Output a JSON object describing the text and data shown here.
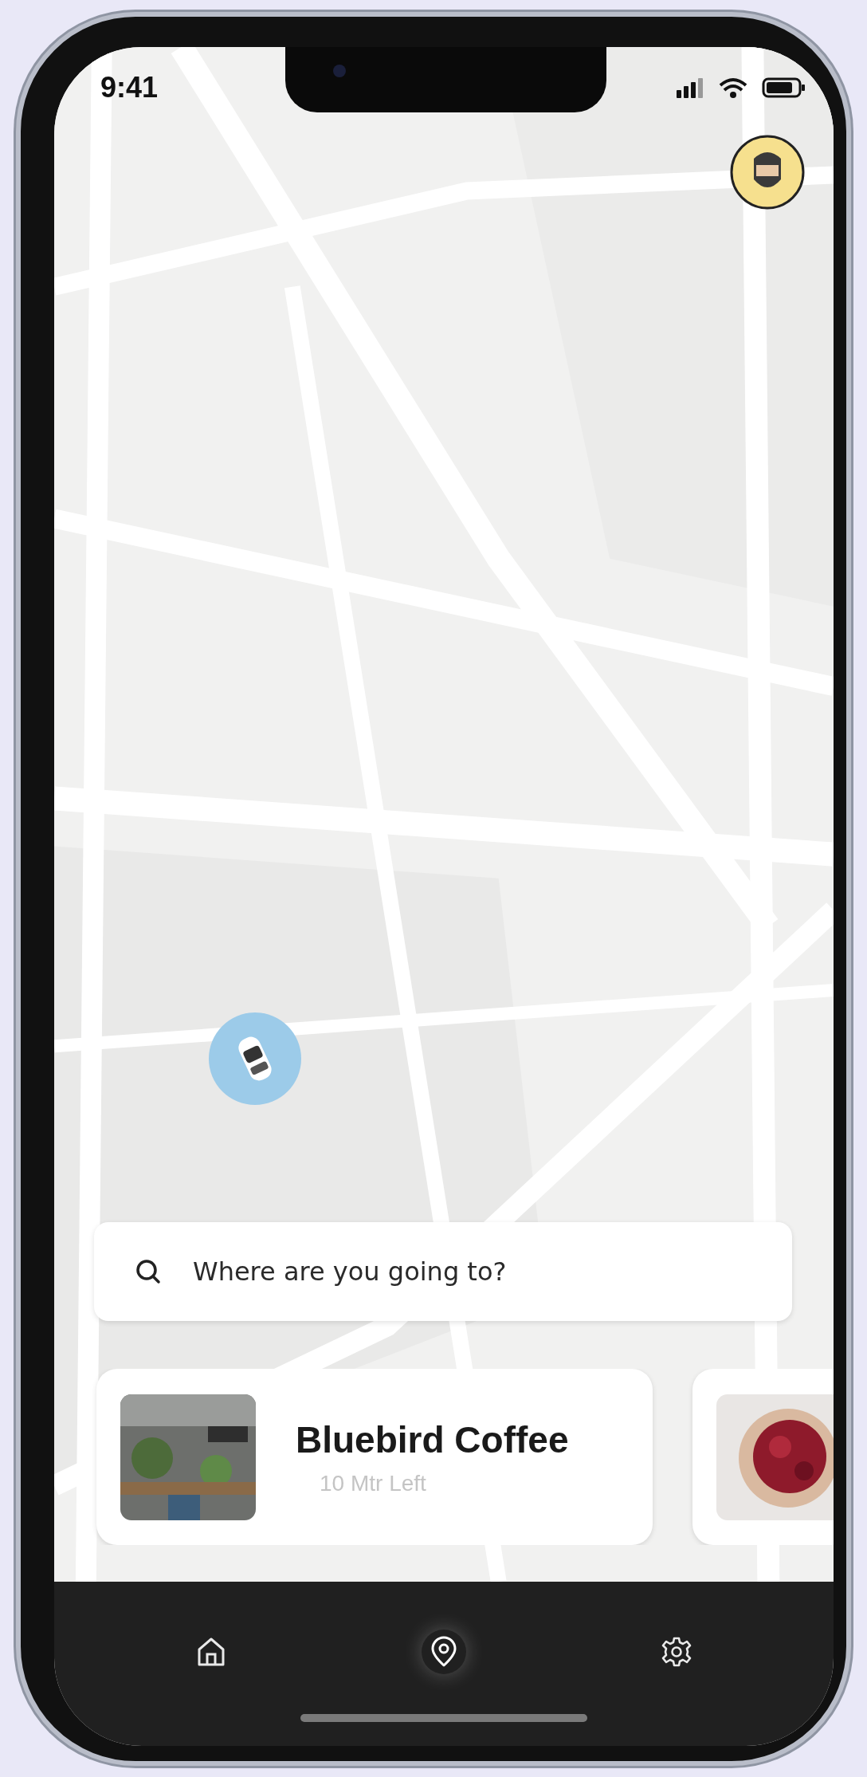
{
  "status_bar": {
    "time": "9:41"
  },
  "search": {
    "placeholder": "Where are you going to?"
  },
  "places": [
    {
      "kind": "place",
      "name": "Bluebird Coffee",
      "distance": "10 Mtr Left"
    },
    {
      "kind": "picture"
    }
  ],
  "nav": [
    {
      "kind": "home",
      "selected": false
    },
    {
      "kind": "location",
      "selected": true
    },
    {
      "kind": "settings",
      "selected": false
    }
  ]
}
